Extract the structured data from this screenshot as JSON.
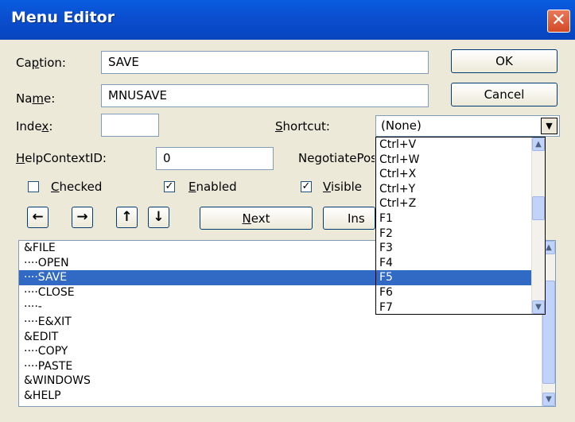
{
  "window": {
    "title": "Menu Editor",
    "close_glyph": "✕"
  },
  "caption": {
    "label": "Caption:",
    "value": "SAVE"
  },
  "name": {
    "label": "Name:",
    "value": "MNUSAVE"
  },
  "index": {
    "label": "Index:",
    "value": ""
  },
  "shortcut": {
    "label": "Shortcut:",
    "value": "(None)"
  },
  "helpcontext": {
    "label": "HelpContextID:",
    "value": "0"
  },
  "negotiate": {
    "label": "NegotiatePosition:"
  },
  "checkboxes": {
    "checked": {
      "label": "Checked",
      "checked": false
    },
    "enabled": {
      "label": "Enabled",
      "checked": true
    },
    "visible": {
      "label": "Visible",
      "checked": true
    }
  },
  "buttons": {
    "ok": "OK",
    "cancel": "Cancel",
    "next": "Next",
    "insert": "Insert"
  },
  "arrows": [
    "←",
    "→",
    "↑",
    "↓"
  ],
  "menu_items": [
    "&FILE",
    "····OPEN",
    "····SAVE",
    "····CLOSE",
    "····-",
    "····E&XIT",
    "&EDIT",
    "····COPY",
    "····PASTE",
    "&WINDOWS",
    "&HELP"
  ],
  "menu_selected_index": 2,
  "shortcut_options": [
    "Ctrl+V",
    "Ctrl+W",
    "Ctrl+X",
    "Ctrl+Y",
    "Ctrl+Z",
    "F1",
    "F2",
    "F3",
    "F4",
    "F5",
    "F6",
    "F7"
  ],
  "shortcut_selected_index": 9,
  "colors": {
    "title_bar": "#0a4fd1",
    "selection": "#316ac5",
    "dialog_bg": "#ece9d8"
  }
}
